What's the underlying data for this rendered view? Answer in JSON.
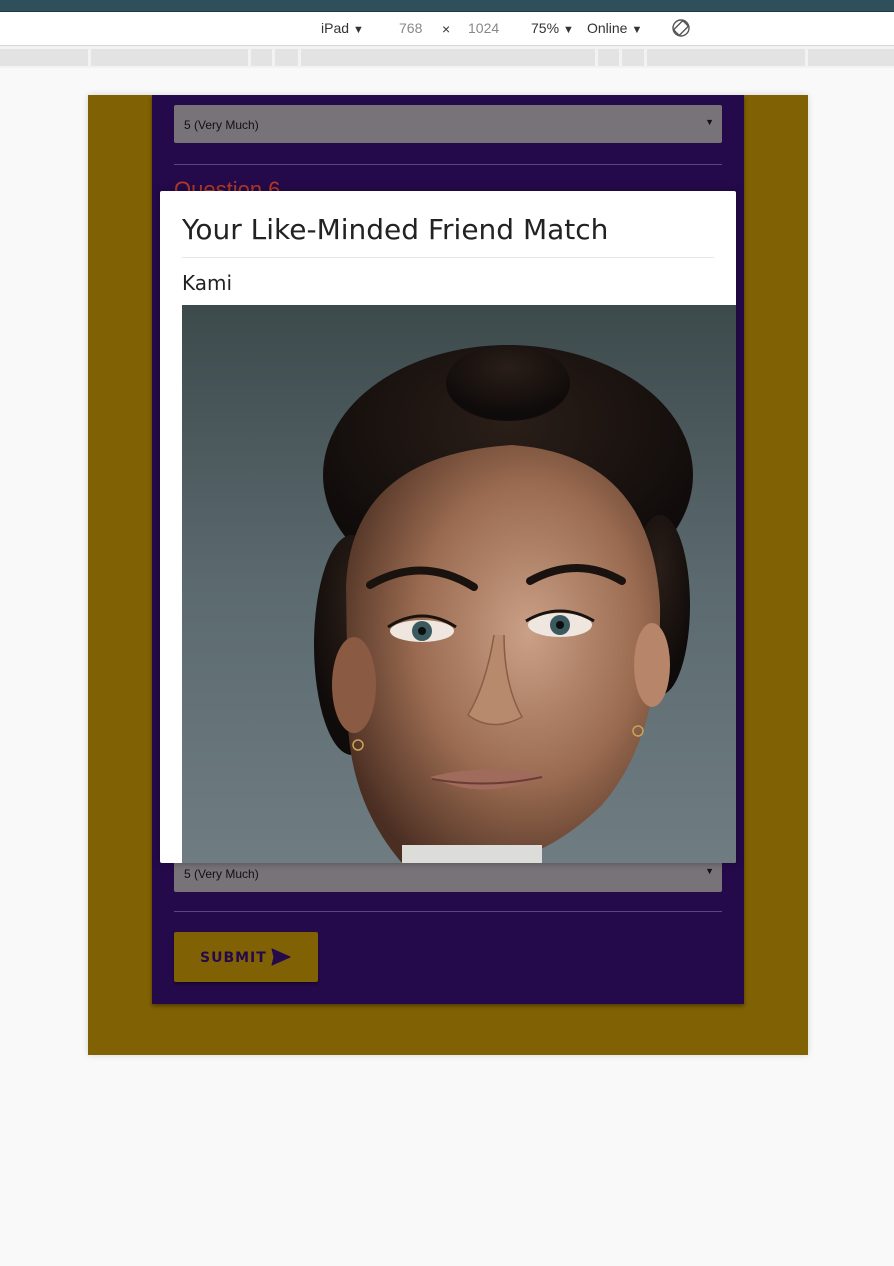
{
  "devtools": {
    "device": "iPad",
    "width": "768",
    "times": "×",
    "height": "1024",
    "zoom": "75%",
    "network": "Online",
    "caret": "▼",
    "rotate_icon": "rotate-icon"
  },
  "form": {
    "top_select_value": "5 (Very Much)",
    "question_title": "Question 6",
    "bottom_select_value": "5 (Very Much)",
    "select_arrow": "▼",
    "submit_label": "SUBMIT",
    "submit_icon": "send-icon"
  },
  "modal": {
    "title": "Your Like-Minded Friend Match",
    "match_name": "Kami",
    "photo_icon": "portrait-photo"
  },
  "colors": {
    "page_bg": "#f9f9f9",
    "viewport_bg": "#806104",
    "card_bg": "#250a4b",
    "select_bg": "#787378",
    "question_color": "#b23a2a",
    "modal_bg": "#ffffff"
  }
}
